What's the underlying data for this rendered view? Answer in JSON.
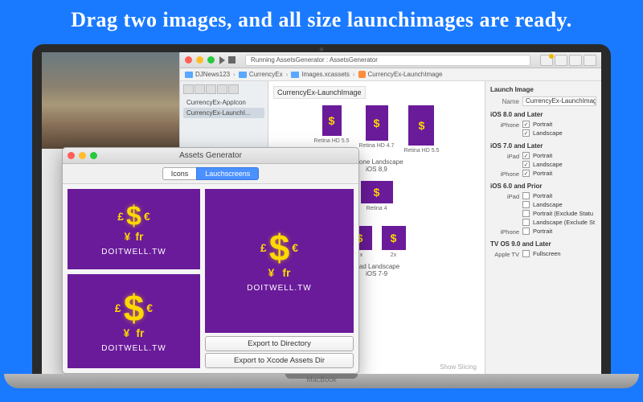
{
  "headline": "Drag two images, and all size launchimages are ready.",
  "macbook_label": "MacBook",
  "xcode": {
    "status": "Running AssetsGenerator : AssetsGenerator",
    "warning_badge": "2",
    "breadcrumb": [
      "DJNews123",
      "CurrencyEx",
      "Images.xcassets",
      "CurrencyEx-LaunchImage"
    ],
    "left_items": [
      "CurrencyEx-AppIcon",
      "CurrencyEx-LaunchI..."
    ],
    "center_title": "CurrencyEx-LaunchImage",
    "previews_row1": [
      {
        "label": "Retina HD 5.5"
      },
      {
        "label": "Retina HD 4.7"
      },
      {
        "label": "Retina HD 5.5"
      }
    ],
    "section1_label": "iPhone Landscape\niOS 8,9",
    "previews_row2": [
      {
        "label": "Retina 4"
      }
    ],
    "previews_row3": [
      {
        "label": "1x"
      },
      {
        "label": "2x"
      }
    ],
    "section3_label": "iPad Landscape\niOS 7-9",
    "show_slicing": "Show Slicing",
    "inspector": {
      "title": "Launch Image",
      "name_label": "Name",
      "name_value": "CurrencyEx-LaunchImag",
      "groups": [
        {
          "title": "iOS 8.0 and Later",
          "devices": [
            {
              "dev": "iPhone",
              "opts": [
                {
                  "l": "Portrait",
                  "c": true
                },
                {
                  "l": "Landscape",
                  "c": true
                }
              ]
            }
          ]
        },
        {
          "title": "iOS 7.0 and Later",
          "devices": [
            {
              "dev": "iPad",
              "opts": [
                {
                  "l": "Portrait",
                  "c": true
                },
                {
                  "l": "Landscape",
                  "c": true
                }
              ]
            },
            {
              "dev": "iPhone",
              "opts": [
                {
                  "l": "Portrait",
                  "c": true
                }
              ]
            }
          ]
        },
        {
          "title": "iOS 6.0 and Prior",
          "devices": [
            {
              "dev": "iPad",
              "opts": [
                {
                  "l": "Portrait",
                  "c": false
                },
                {
                  "l": "Landscape",
                  "c": false
                },
                {
                  "l": "Portrait (Exclude Statu",
                  "c": false
                },
                {
                  "l": "Landscape (Exclude St",
                  "c": false
                }
              ]
            },
            {
              "dev": "iPhone",
              "opts": [
                {
                  "l": "Portrait",
                  "c": false
                }
              ]
            }
          ]
        },
        {
          "title": "TV OS 9.0 and Later",
          "devices": [
            {
              "dev": "Apple TV",
              "opts": [
                {
                  "l": "Fullscreen",
                  "c": false
                }
              ]
            }
          ]
        }
      ]
    }
  },
  "ag": {
    "title": "Assets Generator",
    "tab_icons": "Icons",
    "tab_launch": "Lauchscreens",
    "brand_text": "DOITWELL.TW",
    "btn_export_dir": "Export to Directory",
    "btn_export_xcode": "Export to Xcode Assets Dir"
  }
}
